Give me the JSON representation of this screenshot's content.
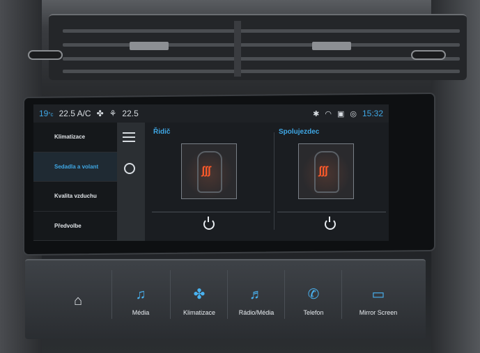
{
  "status_bar": {
    "temp_left": "19",
    "temp_left_unit": "°c",
    "ac_temp": "22.5 A/C",
    "seat_temp": "22.5",
    "clock": "15:32"
  },
  "menu": {
    "items": [
      {
        "label": "Klimatizace",
        "active": false
      },
      {
        "label": "Sedadla a volant",
        "active": true
      },
      {
        "label": "Kvalita vzduchu",
        "active": false
      },
      {
        "label": "Předvolbe",
        "active": false
      }
    ]
  },
  "driver": {
    "title": "Řidič",
    "heat_glyph": "ʃʃʃ"
  },
  "passenger": {
    "title": "Spolujezdec",
    "heat_glyph": "ʃʃʃ"
  },
  "touchbar": {
    "buttons": [
      {
        "label": "",
        "icon": "home-icon",
        "glyph": "⌂"
      },
      {
        "label": "Média",
        "icon": "music-icon",
        "glyph": "♫"
      },
      {
        "label": "Klimatizace",
        "icon": "fan-icon",
        "glyph": "✤"
      },
      {
        "label": "Rádio/Média",
        "icon": "radio-media-icon",
        "glyph": "♬"
      },
      {
        "label": "Telefon",
        "icon": "phone-icon",
        "glyph": "✆"
      },
      {
        "label": "Mirror Screen",
        "icon": "mirror-screen-icon",
        "glyph": "▭"
      }
    ]
  },
  "colors": {
    "accent": "#3fa8e6",
    "heat": "#ff5a2a"
  }
}
